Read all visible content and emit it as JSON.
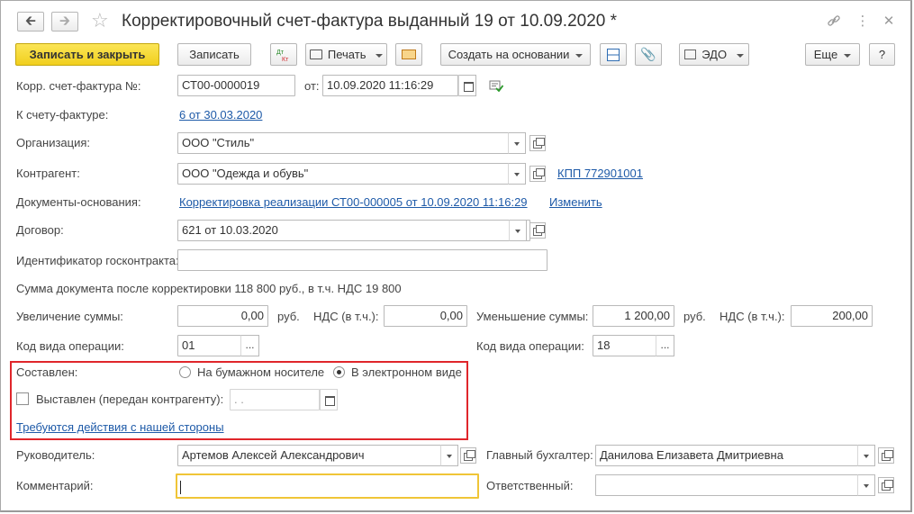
{
  "window": {
    "title": "Корректировочный счет-фактура выданный 19 от 10.09.2020 *"
  },
  "toolbar": {
    "save_close": "Записать и закрыть",
    "save": "Записать",
    "print": "Печать",
    "create_based": "Создать на основании",
    "edo": "ЭДО",
    "more": "Еще",
    "help": "?"
  },
  "form": {
    "corr_invoice_label": "Корр. счет-фактура №:",
    "corr_invoice_number": "СТ00-0000019",
    "date_label": "от:",
    "date_value": "10.09.2020 11:16:29",
    "to_invoice_label": "К счету-фактуре:",
    "to_invoice_link": "6 от 30.03.2020",
    "org_label": "Организация:",
    "org_value": "ООО \"Стиль\"",
    "counterparty_label": "Контрагент:",
    "counterparty_value": "ООО \"Одежда и обувь\"",
    "kpp_link": "КПП 772901001",
    "base_docs_label": "Документы-основания:",
    "base_docs_link": "Корректировка реализации СТ00-000005 от 10.09.2020 11:16:29",
    "change_link": "Изменить",
    "contract_label": "Договор:",
    "contract_value": "621 от 10.03.2020",
    "gov_contract_label": "Идентификатор госконтракта:",
    "gov_contract_value": "",
    "sum_after_text": "Сумма документа после корректировки 118 800 руб., в т.ч. НДС 19 800",
    "increase_label": "Увеличение суммы:",
    "increase_value": "0,00",
    "rub1": "руб.",
    "vat_incl_label1": "НДС (в т.ч.):",
    "vat_increase_value": "0,00",
    "decrease_label": "Уменьшение суммы:",
    "decrease_value": "1 200,00",
    "rub2": "руб.",
    "vat_incl_label2": "НДС (в т.ч.):",
    "vat_decrease_value": "200,00",
    "op_code_label1": "Код вида операции:",
    "op_code_value1": "01",
    "op_code_label2": "Код вида операции:",
    "op_code_value2": "18",
    "dots": "...",
    "composed_label": "Составлен:",
    "paper_option": "На бумажном носителе",
    "electronic_option": "В электронном виде",
    "issued_label": "Выставлен (передан контрагенту):",
    "issued_date_placeholder": " .  .",
    "actions_link": "Требуются действия с нашей стороны",
    "head_label": "Руководитель:",
    "head_value": "Артемов Алексей Александрович",
    "chief_acc_label": "Главный бухгалтер:",
    "chief_acc_value": "Данилова Елизавета Дмитриевна",
    "comment_label": "Комментарий:",
    "comment_value": "",
    "responsible_label": "Ответственный:",
    "responsible_value": ""
  },
  "state": {
    "composed_selected": "electronic",
    "issued_checked": false
  }
}
